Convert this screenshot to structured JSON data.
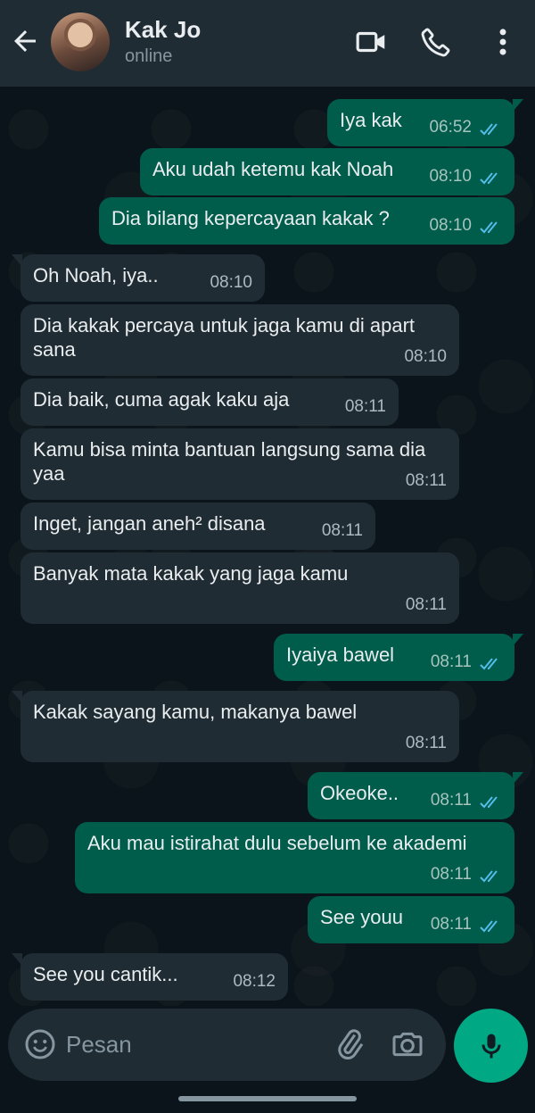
{
  "header": {
    "contact_name": "Kak Jo",
    "status": "online"
  },
  "messages": [
    {
      "dir": "out",
      "text": "Iya kak",
      "time": "06:52"
    },
    {
      "dir": "out",
      "text": "Aku udah ketemu kak Noah",
      "time": "08:10"
    },
    {
      "dir": "out",
      "text": "Dia bilang kepercayaan kakak ?",
      "time": "08:10"
    },
    {
      "dir": "in",
      "text": "Oh Noah, iya..",
      "time": "08:10"
    },
    {
      "dir": "in",
      "text": "Dia kakak percaya untuk jaga kamu di apart sana",
      "time": "08:10"
    },
    {
      "dir": "in",
      "text": "Dia baik, cuma agak kaku aja",
      "time": "08:11"
    },
    {
      "dir": "in",
      "text": "Kamu bisa minta bantuan langsung sama dia yaa",
      "time": "08:11"
    },
    {
      "dir": "in",
      "text": "Inget, jangan aneh² disana",
      "time": "08:11"
    },
    {
      "dir": "in",
      "text": "Banyak mata kakak yang jaga kamu",
      "time": "08:11"
    },
    {
      "dir": "out",
      "text": "Iyaiya bawel",
      "time": "08:11"
    },
    {
      "dir": "in",
      "text": "Kakak sayang kamu, makanya bawel",
      "time": "08:11"
    },
    {
      "dir": "out",
      "text": "Okeoke..",
      "time": "08:11"
    },
    {
      "dir": "out",
      "text": "Aku mau istirahat dulu sebelum ke akademi",
      "time": "08:11"
    },
    {
      "dir": "out",
      "text": "See youu",
      "time": "08:11"
    },
    {
      "dir": "in",
      "text": "See you cantik...",
      "time": "08:12"
    }
  ],
  "composer": {
    "placeholder": "Pesan"
  },
  "colors": {
    "outgoing_bubble": "#005c4b",
    "incoming_bubble": "#202c33",
    "read_ticks": "#53bdeb",
    "accent": "#00a884"
  }
}
